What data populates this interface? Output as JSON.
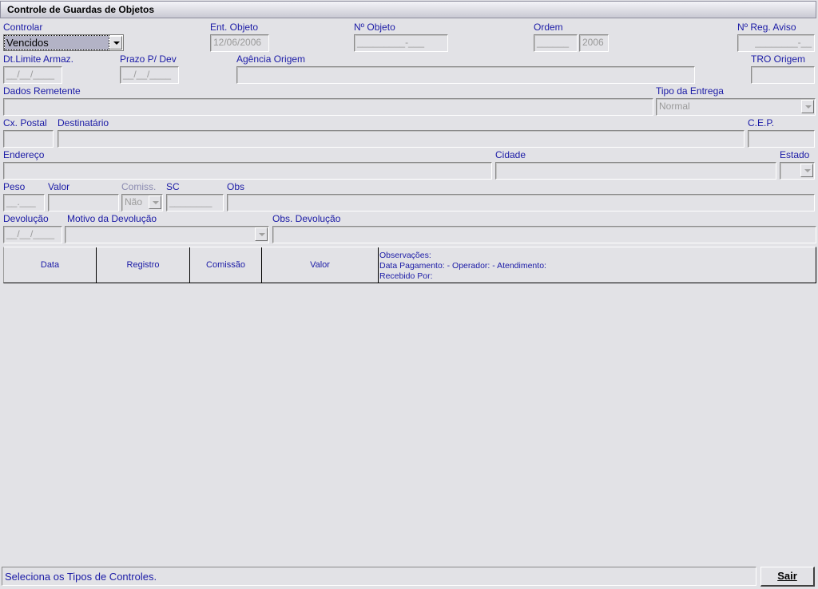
{
  "window": {
    "title": "Controle de Guardas de Objetos"
  },
  "labels": {
    "controlar": "Controlar",
    "ent_objeto": "Ent. Objeto",
    "n_objeto": "Nº Objeto",
    "ordem": "Ordem",
    "n_reg_aviso": "Nº Reg. Aviso",
    "dt_limite": "Dt.Limite Armaz.",
    "prazo_dev": "Prazo P/ Dev",
    "agencia_origem": "Agência Origem",
    "tro_origem": "TRO Origem",
    "dados_remetente": "Dados Remetente",
    "tipo_entrega": "Tipo da Entrega",
    "cx_postal": "Cx. Postal",
    "destinatario": "Destinatário",
    "cep": "C.E.P.",
    "endereco": "Endereço",
    "cidade": "Cidade",
    "estado": "Estado",
    "peso": "Peso",
    "valor": "Valor",
    "comiss": "Comiss.",
    "sc": "SC",
    "obs": "Obs",
    "devolucao": "Devolução",
    "motivo_devolucao": "Motivo da Devolução",
    "obs_devolucao": "Obs. Devolução"
  },
  "fields": {
    "controlar_value": "Vencidos",
    "ent_objeto_value": "12/06/2006",
    "n_objeto_mask": "_________-___",
    "ordem_value": "______",
    "ordem_year": "2006",
    "n_reg_aviso_mask": "________-__",
    "dt_limite_mask": "__/__/____",
    "prazo_dev_mask": "__/__/____",
    "tipo_entrega_value": "Normal",
    "peso_mask": "__.___",
    "comiss_value": "Não",
    "sc_mask": "________",
    "devolucao_mask": "__/__/____"
  },
  "grid": {
    "columns": [
      "Data",
      "Registro",
      "Comissão",
      "Valor"
    ],
    "notes_line1": "Observações:",
    "notes_line2": "Data Pagamento:  -  Operador:  -  Atendimento:",
    "notes_line3": "Recebido Por:"
  },
  "status": {
    "text": "Seleciona os Tipos de Controles."
  },
  "buttons": {
    "sair": "Sair"
  },
  "colors": {
    "background": "#e2e2e6",
    "label": "#1a1aa6",
    "selection": "#b3b3c6"
  }
}
